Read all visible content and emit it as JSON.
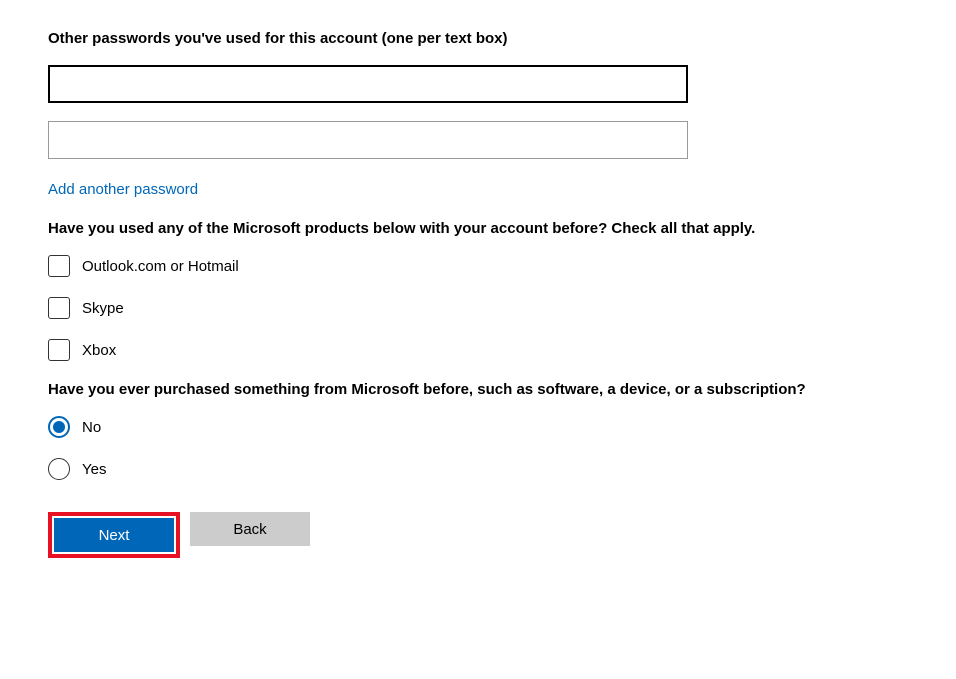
{
  "passwords": {
    "label": "Other passwords you've used for this account (one per text box)",
    "field1_value": "",
    "field2_value": "",
    "add_link": "Add another password"
  },
  "products": {
    "label": "Have you used any of the Microsoft products below with your account before? Check all that apply.",
    "options": [
      {
        "label": "Outlook.com or Hotmail",
        "checked": false
      },
      {
        "label": "Skype",
        "checked": false
      },
      {
        "label": "Xbox",
        "checked": false
      }
    ]
  },
  "purchase": {
    "label": "Have you ever purchased something from Microsoft before, such as software, a device, or a subscription?",
    "options": [
      {
        "label": "No",
        "selected": true
      },
      {
        "label": "Yes",
        "selected": false
      }
    ]
  },
  "buttons": {
    "next": "Next",
    "back": "Back"
  }
}
